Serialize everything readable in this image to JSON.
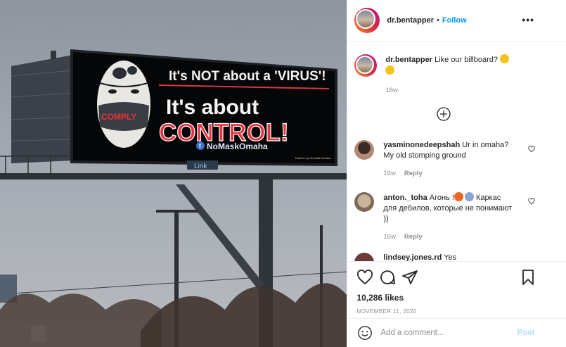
{
  "post": {
    "username": "dr.bentapper",
    "follow_label": "Follow",
    "dot": "•",
    "more_label": "•••"
  },
  "billboard": {
    "line1": "It's NOT about a 'VIRUS'!",
    "line2": "It's about",
    "line3": "CONTROL!",
    "mask_word": "COMPLY",
    "handle": "NoMaskOmaha",
    "small_print": "Paid for by No Mask Omaha",
    "brand": "Link"
  },
  "caption": {
    "username": "dr.bentapper",
    "text": "Like our billboard?",
    "time": "18w"
  },
  "comments": [
    {
      "username": "yasminonedeepshah",
      "text": "Ur in omaha? My old stomping ground",
      "time": "16w",
      "reply_label": "Reply"
    },
    {
      "username": "anton._toha",
      "text_a": "Агонь !",
      "text_b": " Каркас для дебилов, которые не понимают ))",
      "time": "16w",
      "reply_label": "Reply"
    },
    {
      "username": "lindsey.jones.rd",
      "text": "Yes"
    }
  ],
  "likes": "10,286 likes",
  "date": "NOVEMBER 11, 2020",
  "add_comment": {
    "placeholder": "Add a comment...",
    "post_label": "Post"
  },
  "colors": {
    "follow": "#0095f6",
    "meta": "#8e8e8e",
    "post_disabled": "#b2dffc",
    "billboard_red": "#e8333f"
  }
}
